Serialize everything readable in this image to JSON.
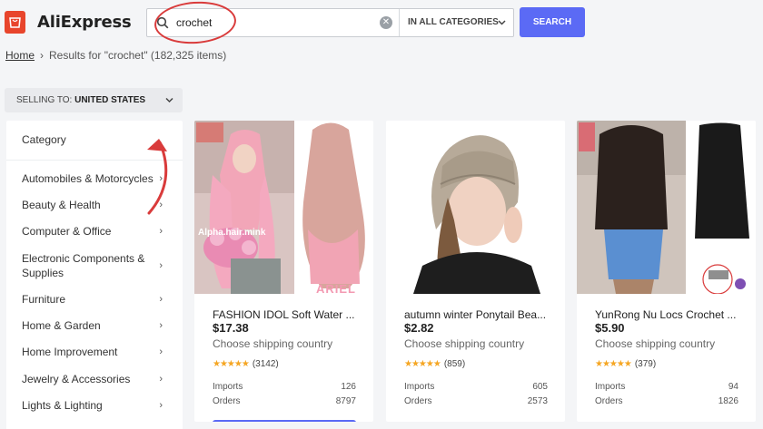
{
  "header": {
    "logo_text": "AliExpress",
    "search": {
      "value": "crochet",
      "placeholder": ""
    },
    "category_select": "IN ALL CATEGORIES",
    "search_button": "SEARCH"
  },
  "breadcrumb": {
    "home": "Home",
    "separator": "›",
    "results": "Results for \"crochet\" (182,325 items)"
  },
  "selling_to": {
    "label": "SELLING TO:",
    "value": "UNITED STATES"
  },
  "categories": {
    "title": "Category",
    "items": [
      {
        "label": "Automobiles & Motorcycles"
      },
      {
        "label": "Beauty & Health"
      },
      {
        "label": "Computer & Office"
      },
      {
        "label": "Electronic Components & Supplies"
      },
      {
        "label": "Furniture"
      },
      {
        "label": "Home & Garden"
      },
      {
        "label": "Home Improvement"
      },
      {
        "label": "Jewelry & Accessories"
      },
      {
        "label": "Lights & Lighting"
      }
    ]
  },
  "products": [
    {
      "title": "FASHION IDOL Soft Water ...",
      "price": "$17.38",
      "shipping": "Choose shipping country",
      "stars": "★★★★★",
      "reviews": "(3142)",
      "imports_label": "Imports",
      "imports": "126",
      "orders_label": "Orders",
      "orders": "8797",
      "image_caption": "ARIEL",
      "image_watermark": "Alpha.hair.mink"
    },
    {
      "title": "autumn winter Ponytail Bea...",
      "price": "$2.82",
      "shipping": "Choose shipping country",
      "stars": "★★★★★",
      "reviews": "(859)",
      "imports_label": "Imports",
      "imports": "605",
      "orders_label": "Orders",
      "orders": "2573"
    },
    {
      "title": "YunRong Nu Locs Crochet ...",
      "price": "$5.90",
      "shipping": "Choose shipping country",
      "stars": "★★★★★",
      "reviews": "(379)",
      "imports_label": "Imports",
      "imports": "94",
      "orders_label": "Orders",
      "orders": "1826"
    }
  ],
  "colors": {
    "accent": "#5b6af5",
    "brand": "#e8452c",
    "star": "#f5a623",
    "annotation": "#d93b3b"
  }
}
